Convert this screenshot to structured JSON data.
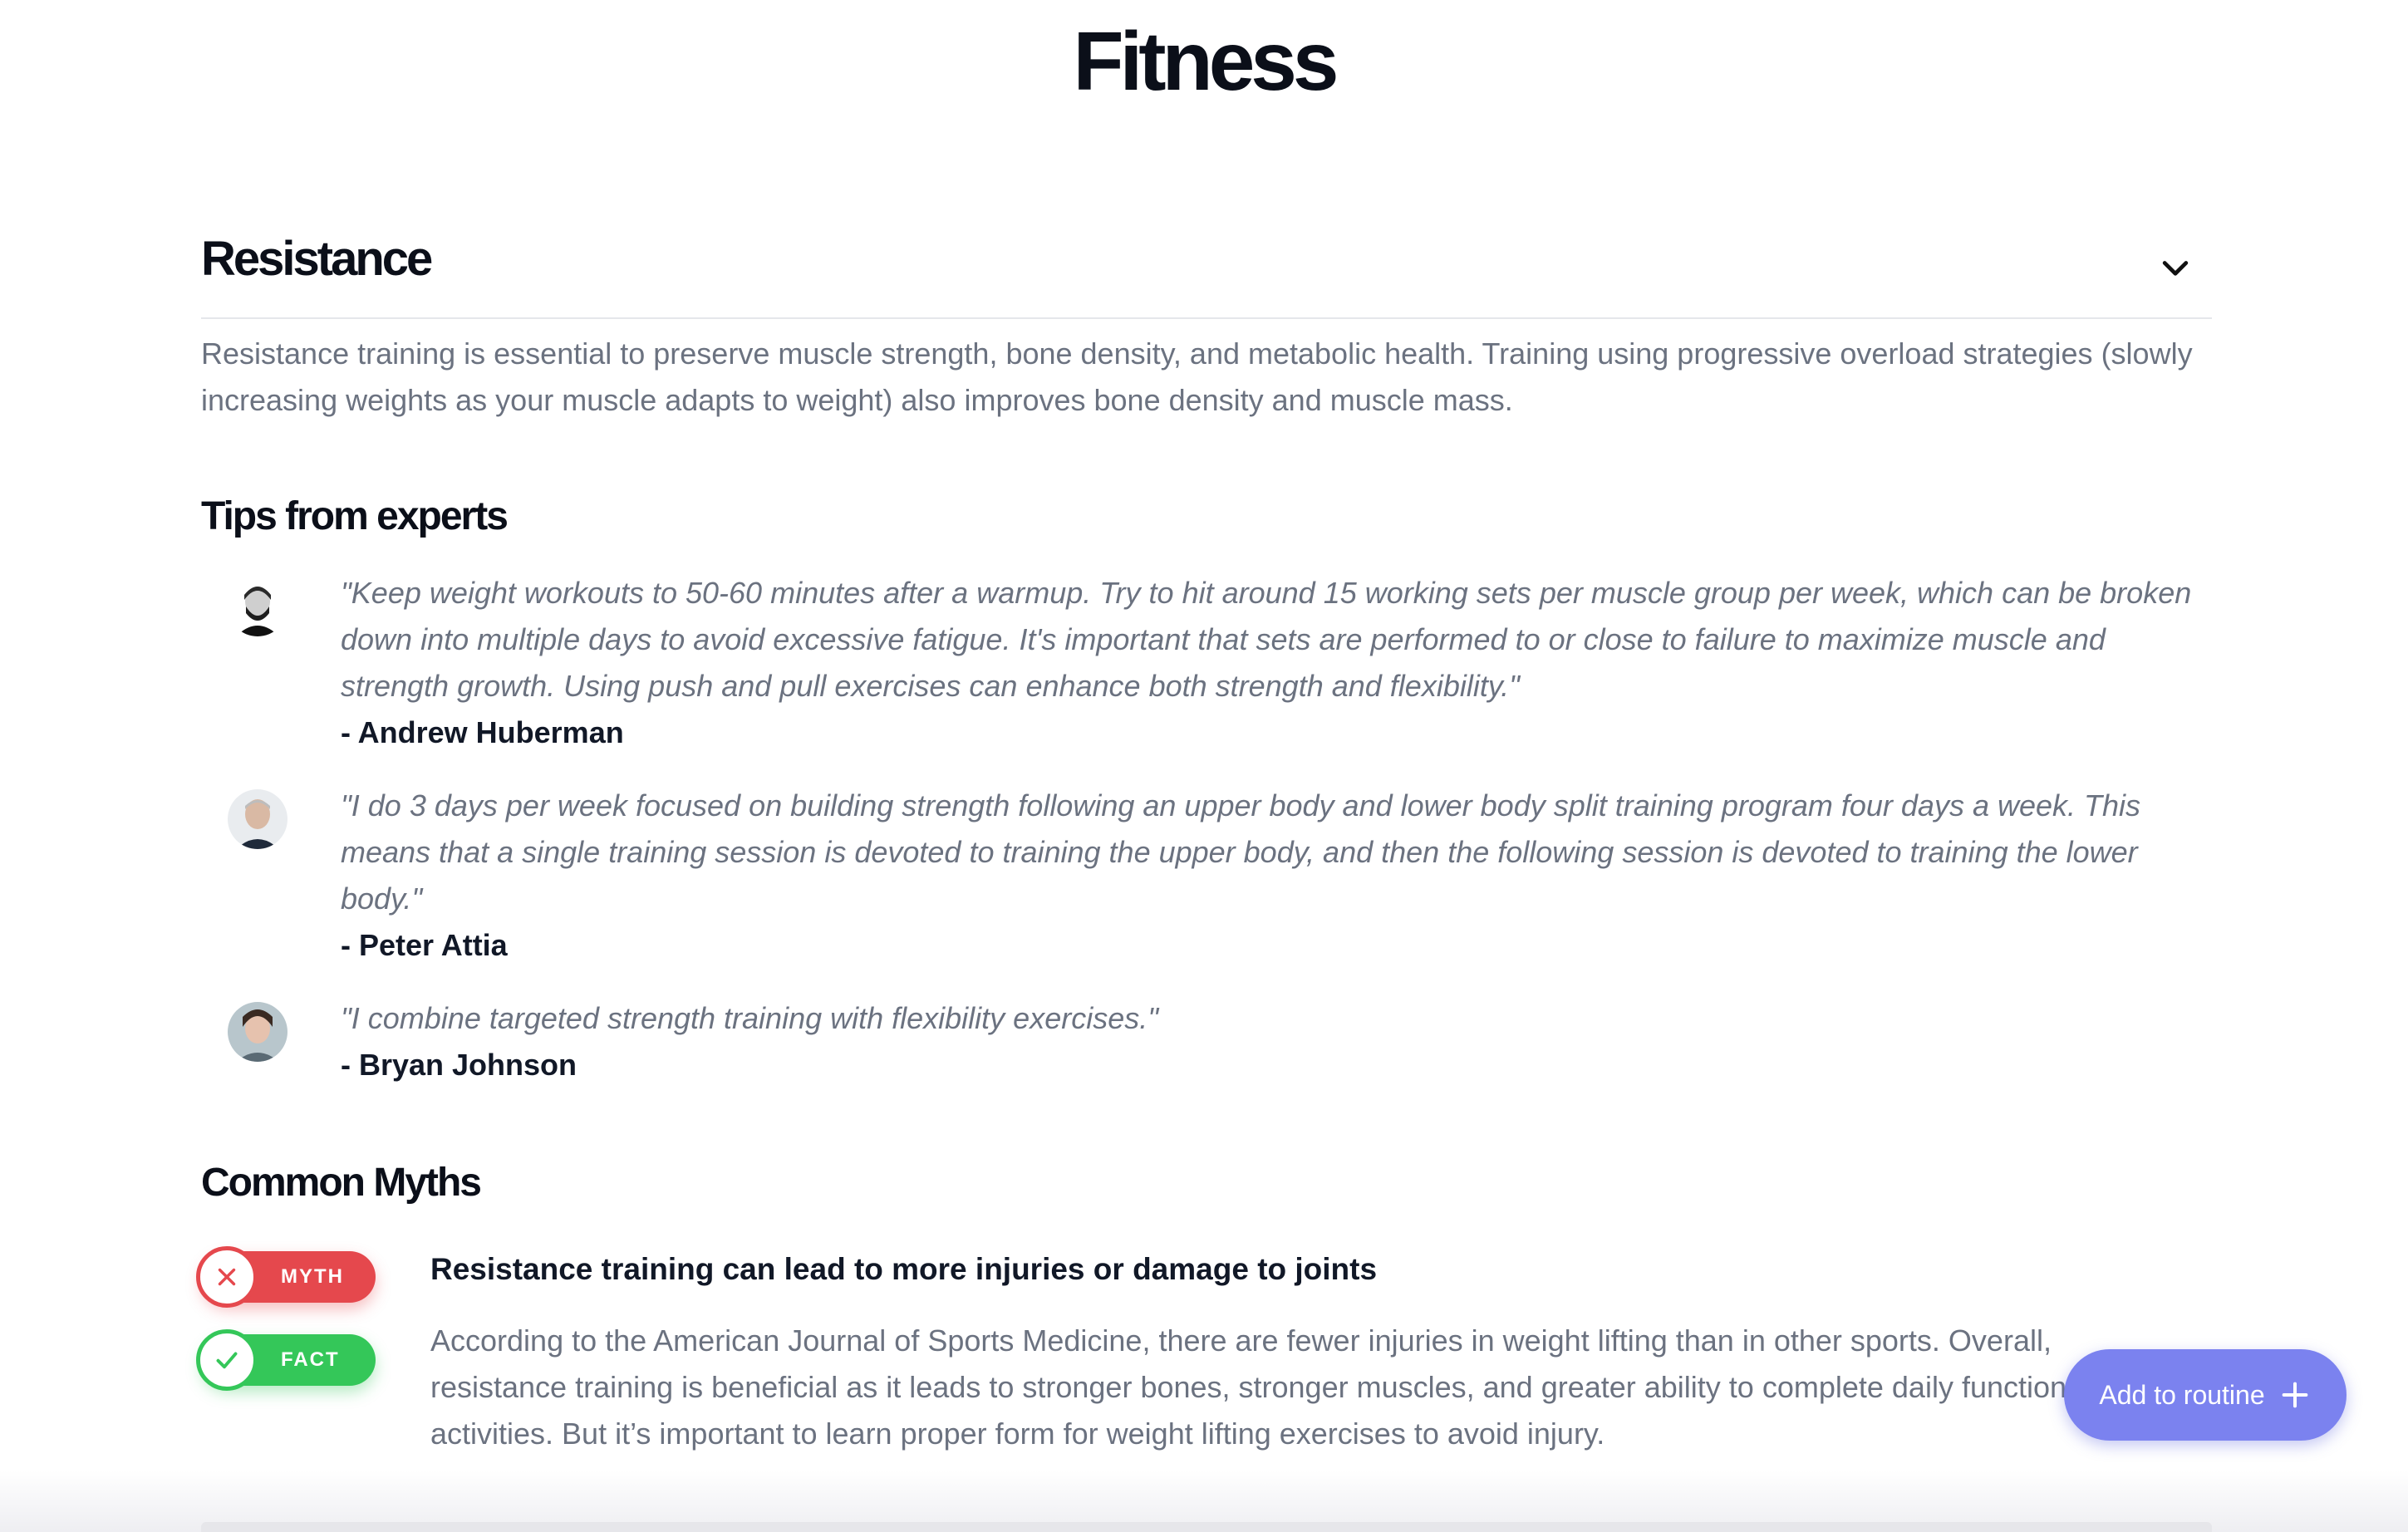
{
  "page": {
    "title": "Fitness"
  },
  "section": {
    "title": "Resistance",
    "intro": "Resistance training is essential to preserve muscle strength, bone density, and metabolic health. Training using progressive overload strategies (slowly increasing weights as your muscle adapts to weight) also improves bone density and muscle mass."
  },
  "tips": {
    "heading": "Tips from experts",
    "items": [
      {
        "quote": "\"Keep weight workouts to 50-60 minutes after a warmup. Try to hit around 15 working sets per muscle group per week, which can be broken down into multiple days to avoid excessive fatigue. It's important that sets are performed to or close to failure to maximize muscle and strength growth. Using push and pull exercises can enhance both strength and flexibility.\"",
        "author": "- Andrew Huberman"
      },
      {
        "quote": "\"I do 3 days per week focused on building strength following an upper body and lower body split training program four days a week. This means that a single training session is devoted to training the upper body, and then the following session is devoted to training the lower body.\"",
        "author": "- Peter Attia"
      },
      {
        "quote": "\"I combine targeted strength training with flexibility exercises.\"",
        "author": "- Bryan Johnson"
      }
    ]
  },
  "myths": {
    "heading": "Common Myths",
    "myth_badge": "MYTH",
    "fact_badge": "FACT",
    "myth_text": "Resistance training can lead to more injuries or damage to joints",
    "fact_text": "According to the American Journal of Sports Medicine, there are fewer injuries in weight lifting than in other sports. Overall, resistance training is beneficial as it leads to stronger bones, stronger muscles, and greater ability to complete daily functional activities. But it’s important to learn proper form for weight lifting exercises to avoid injury."
  },
  "actions": {
    "add_to_routine": "Add to routine"
  },
  "colors": {
    "myth": "#e5484d",
    "fact": "#34c759",
    "accent": "#7b82ef",
    "muted_text": "#6b7280"
  },
  "icons": [
    "chevron-down-icon",
    "close-icon",
    "check-icon",
    "plus-icon"
  ]
}
